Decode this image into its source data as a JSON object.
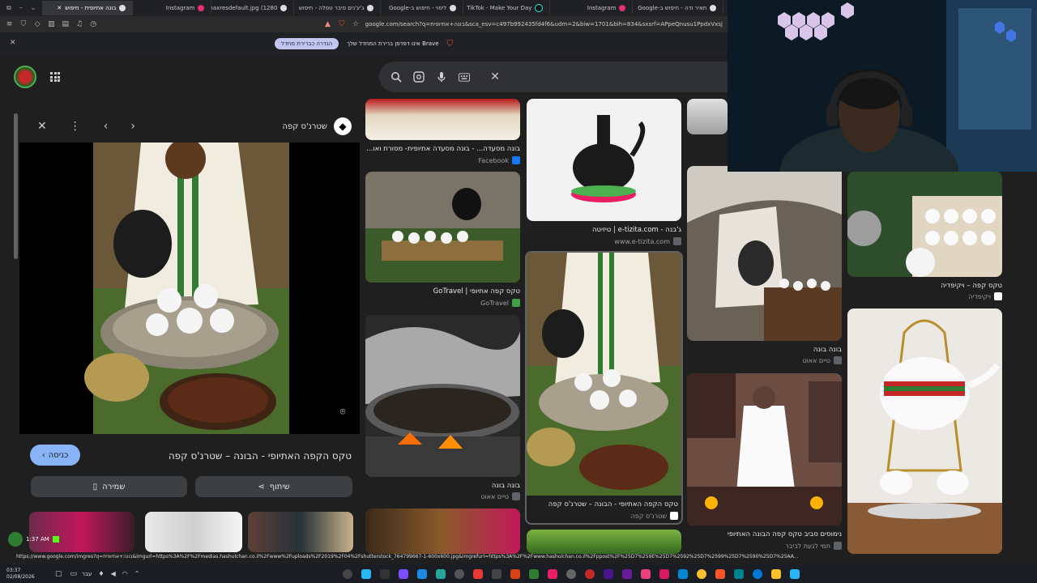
{
  "browser": {
    "tabs": [
      {
        "label": "בונה אתיופית - חיפוש",
        "active": true
      },
      {
        "label": "Instagram"
      },
      {
        "label": "maxresdefault.jpg (1280×"
      },
      {
        "label": "ג'יג'נים סיבר טפלה - חיפוש"
      },
      {
        "label": "ליסוי - חיפוש ב-Google"
      },
      {
        "label": "TikTok - Make Your Day"
      },
      {
        "label": "Instagram"
      },
      {
        "label": "תאיר ודה - חיפוש ב-Google"
      }
    ],
    "url": "google.com/search?q=בונה+אתיופית&sca_esv=c497b992435fd4f6&udm=2&biw=1701&bih=834&sxsrf=APpeQnusu1PpdxVxsjEkw6w26yM_dYFyC...",
    "notice_text": "אינו דפדפן ברירת המחדל שלך Brave",
    "notice_button": "הגדרה כברירת מחדל"
  },
  "side_panel": {
    "source_name": "שטרנ'ס קפה",
    "title": "טקס הקפה האתיופי - הבונה – שטרנ'ס קפה",
    "visit_label": "כניסה",
    "share_label": "שיתוף",
    "save_label": "שמירה"
  },
  "results": [
    {
      "caption": "בונה מסעדה... - בונה מסעדה אתיופית- מסורת ואו...",
      "source": "Facebook"
    },
    {
      "caption": "טקס קפה אתיופי | GoTravel",
      "source": "GoTravel"
    },
    {
      "caption": "בונה בונה",
      "source": "טיים אאוט"
    },
    {
      "caption": "ג'בנה - e-tizita.com | טיזיטה",
      "source": "www.e-tizita.com"
    },
    {
      "caption": "טקס הקפה האתיופי - הבונה – שטרנ'ס קפה",
      "source": "שטרנ'ס קפה"
    },
    {
      "caption": "בונה בונה",
      "source": "טיים אאוט"
    },
    {
      "caption": "נימוסים סביב טקס קפה הבונה האתיופי",
      "source": "תמי לגעת לביבר"
    },
    {
      "caption": "טקס קפה – ויקיפדיה",
      "source": "ויקיפדיה"
    }
  ],
  "status_url": "https://www.google.com/imgres?q=בונה+אתיופית&imgurl=https%3A%2F%2Fmedias.hashulchan.co.il%2Fwww%2Fuploads%2F2019%2F04%2Fshutterstock_764799667-1-600x600.jpg&imgrefurl=https%3A%2F%2Fwww.hashulchan.co.il%2Fppost%2F%25D7%259E%25D7%2592%25D7%2599%25D7%2590%25D7%25AA...",
  "system": {
    "time": "03:37",
    "date": "02/08/2026",
    "lang": "עבר",
    "stream_time": "1:37 AM"
  }
}
